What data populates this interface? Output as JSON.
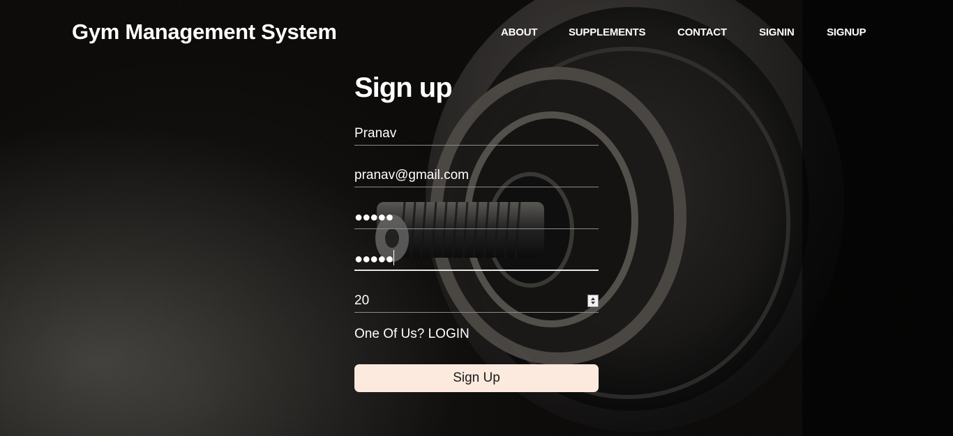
{
  "brand": {
    "title": "Gym Management System"
  },
  "nav": {
    "items": [
      {
        "label": "ABOUT"
      },
      {
        "label": "SUPPLEMENTS"
      },
      {
        "label": "CONTACT"
      },
      {
        "label": "SIGNIN"
      },
      {
        "label": "SIGNUP"
      }
    ]
  },
  "form": {
    "title": "Sign up",
    "name_value": "Pranav",
    "email_value": "pranav@gmail.com",
    "password_value": "●●●●●",
    "confirm_password_value": "●●●●●",
    "age_value": "20",
    "login_prompt": "One Of Us? LOGIN",
    "submit_label": "Sign Up"
  },
  "colors": {
    "button_bg": "#fbeadd",
    "text": "#ffffff",
    "background": "#000000"
  }
}
